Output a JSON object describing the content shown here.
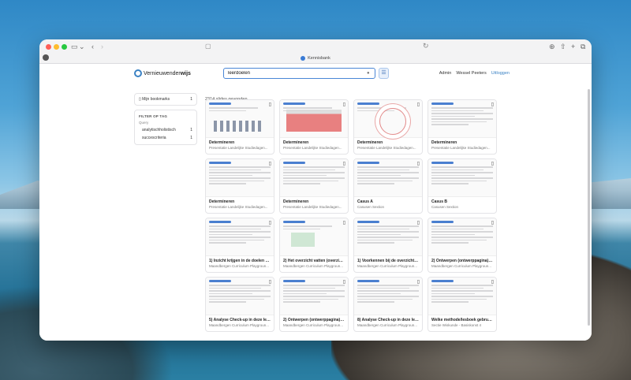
{
  "browser": {
    "tab_title": "Kennisbank"
  },
  "header": {
    "logo_plain": "Vernieuwender",
    "logo_bold": "wijs",
    "search_value": "leerdoelen",
    "nav": [
      "Admin",
      "Wessel Peeters",
      "Uitloggen"
    ]
  },
  "sidebar": {
    "bookmarks_label": "Mijn bookmarks",
    "bookmarks_count": "1",
    "filter_heading": "FILTER OP TAG",
    "query_label": "Query",
    "tags": [
      {
        "label": "analytischholistisch",
        "count": "1"
      },
      {
        "label": "succescriteria",
        "count": "1"
      }
    ]
  },
  "results": {
    "count_text": "2314 slides gevonden"
  },
  "cards": [
    {
      "title": "Determineren",
      "subtitle": "Presentatie Landelijke Studiedagen...",
      "thumb": "people"
    },
    {
      "title": "Determineren",
      "subtitle": "Presentatie Landelijke Studiedagen...",
      "thumb": "table"
    },
    {
      "title": "Determineren",
      "subtitle": "Presentatie Landelijke Studiedagen...",
      "thumb": "circles"
    },
    {
      "title": "Determineren",
      "subtitle": "Presentatie Landelijke Studiedagen...",
      "thumb": "text"
    },
    {
      "title": "Determineren",
      "subtitle": "Presentatie Landelijke Studiedagen...",
      "thumb": "text"
    },
    {
      "title": "Determineren",
      "subtitle": "Presentatie Landelijke Studiedagen...",
      "thumb": "text"
    },
    {
      "title": "Casus A",
      "subtitle": "Casusen Sextion",
      "thumb": "text"
    },
    {
      "title": "Casus B",
      "subtitle": "Casusen Sextion",
      "thumb": "text"
    },
    {
      "title": "1) Inzicht krijgen in de doelen Do...",
      "subtitle": "Maandbergen Curriculum Playgroun...",
      "thumb": "text"
    },
    {
      "title": "2) Het overzicht vatten (overzichtsp...",
      "subtitle": "Maandbergen Curriculum Playgroun...",
      "thumb": "box"
    },
    {
      "title": "1) Voorkennen bij de overzichtspa...",
      "subtitle": "Maandbergen Curriculum Playgroun...",
      "thumb": "text"
    },
    {
      "title": "2) Ontwerpen (ontwerppagina) Do...",
      "subtitle": "Maandbergen Curriculum Playgroun...",
      "thumb": "text"
    },
    {
      "title": "5) Analyse Check-up in deze lesb...",
      "subtitle": "Maandbergen Curriculum Playgroun...",
      "thumb": "text"
    },
    {
      "title": "2) Ontwerpen (ontwerppagina) Do...",
      "subtitle": "Maandbergen Curriculum Playgroun...",
      "thumb": "text"
    },
    {
      "title": "8) Analyse Check-up in deze lesb...",
      "subtitle": "Maandbergen Curriculum Playgroun...",
      "thumb": "text"
    },
    {
      "title": "Welke methode/lesboek gebruik je ...",
      "subtitle": "Sectie Wiskunde - Basiskonst 4",
      "thumb": "text"
    }
  ]
}
